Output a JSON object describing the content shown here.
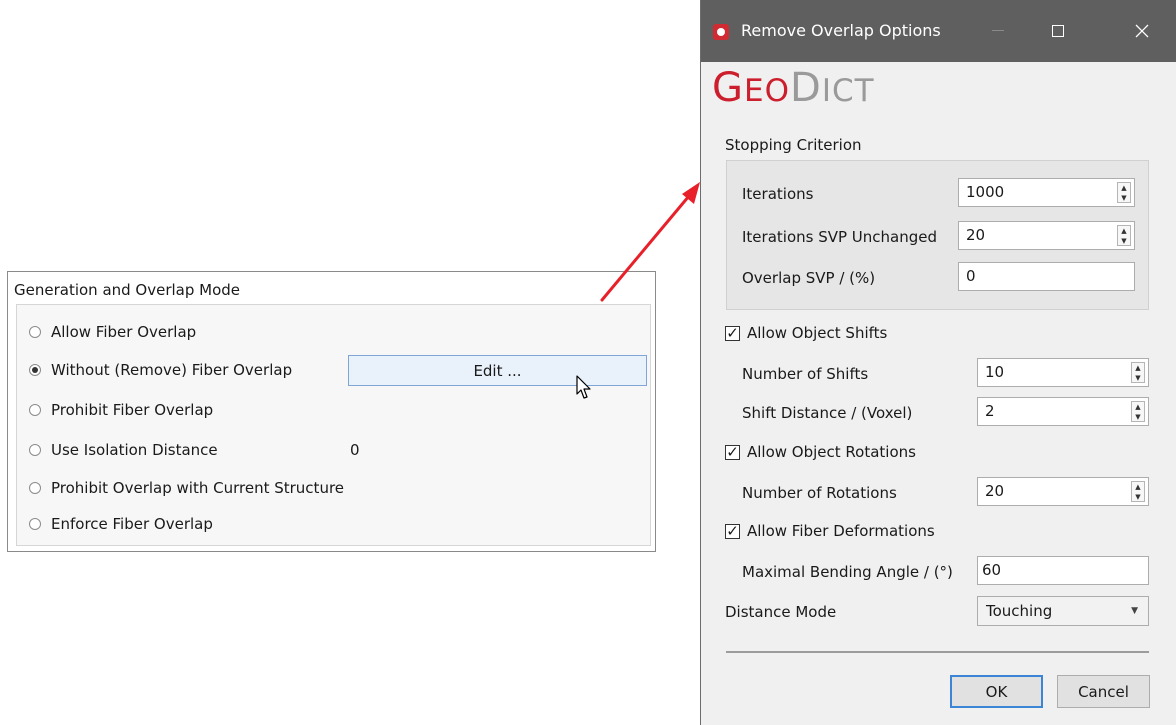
{
  "left_panel": {
    "title": "Generation and Overlap Mode",
    "options": [
      {
        "label": "Allow Fiber Overlap",
        "selected": false
      },
      {
        "label": "Without (Remove) Fiber Overlap",
        "selected": true
      },
      {
        "label": "Prohibit Fiber Overlap",
        "selected": false
      },
      {
        "label": "Use Isolation Distance",
        "selected": false
      },
      {
        "label": "Prohibit Overlap with Current Structure",
        "selected": false
      },
      {
        "label": "Enforce Fiber Overlap",
        "selected": false
      }
    ],
    "edit_button": "Edit ...",
    "isolation_distance": "0"
  },
  "dialog": {
    "title": "Remove Overlap Options",
    "logo_g": "G",
    "logo_eo": "EO",
    "logo_d": "D",
    "logo_ict": "ICT",
    "stopping_criterion": {
      "heading": "Stopping Criterion",
      "iterations_label": "Iterations",
      "iterations_value": "1000",
      "svp_unchanged_label": "Iterations SVP Unchanged",
      "svp_unchanged_value": "20",
      "overlap_svp_label": "Overlap SVP / (%)",
      "overlap_svp_value": "0"
    },
    "object_shifts": {
      "checkbox_label": "Allow Object Shifts",
      "checked": true,
      "num_shifts_label": "Number of Shifts",
      "num_shifts_value": "10",
      "shift_distance_label": "Shift Distance / (Voxel)",
      "shift_distance_value": "2"
    },
    "object_rotations": {
      "checkbox_label": "Allow Object Rotations",
      "checked": true,
      "num_rotations_label": "Number of Rotations",
      "num_rotations_value": "20"
    },
    "fiber_deformations": {
      "checkbox_label": "Allow Fiber Deformations",
      "checked": true,
      "bending_angle_label": "Maximal Bending Angle / (°)",
      "bending_angle_value": "60"
    },
    "distance_mode": {
      "label": "Distance Mode",
      "value": "Touching"
    },
    "ok_label": "OK",
    "cancel_label": "Cancel"
  },
  "colors": {
    "accent_red": "#cc1e2c",
    "titlebar": "#5f5f5f",
    "button_focus": "#3c84d6"
  }
}
